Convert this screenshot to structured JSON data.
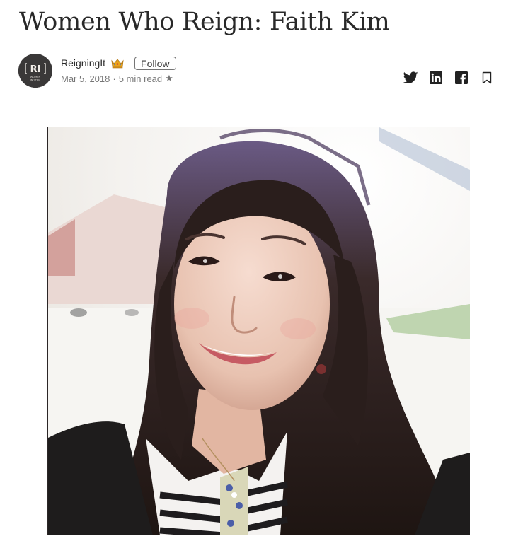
{
  "article": {
    "title": "Women Who Reign: Faith Kim"
  },
  "author": {
    "avatar_text": "RI",
    "avatar_subtext_line1": "WOMEN",
    "avatar_subtext_line2": "IN STEM",
    "name": "ReigningIt",
    "badge_icon": "crown-icon",
    "follow_label": "Follow",
    "date": "Mar 5, 2018",
    "separator": "·",
    "read_time": "5 min read",
    "member_icon": "star-icon"
  },
  "share": {
    "icons": [
      "twitter-icon",
      "linkedin-icon",
      "facebook-icon",
      "bookmark-icon"
    ]
  },
  "hero_image": {
    "subject": "portrait-photo"
  },
  "colors": {
    "text_primary": "#292929",
    "text_secondary": "#757575",
    "avatar_bg": "#3a3838",
    "crown": "#e8a51a"
  }
}
